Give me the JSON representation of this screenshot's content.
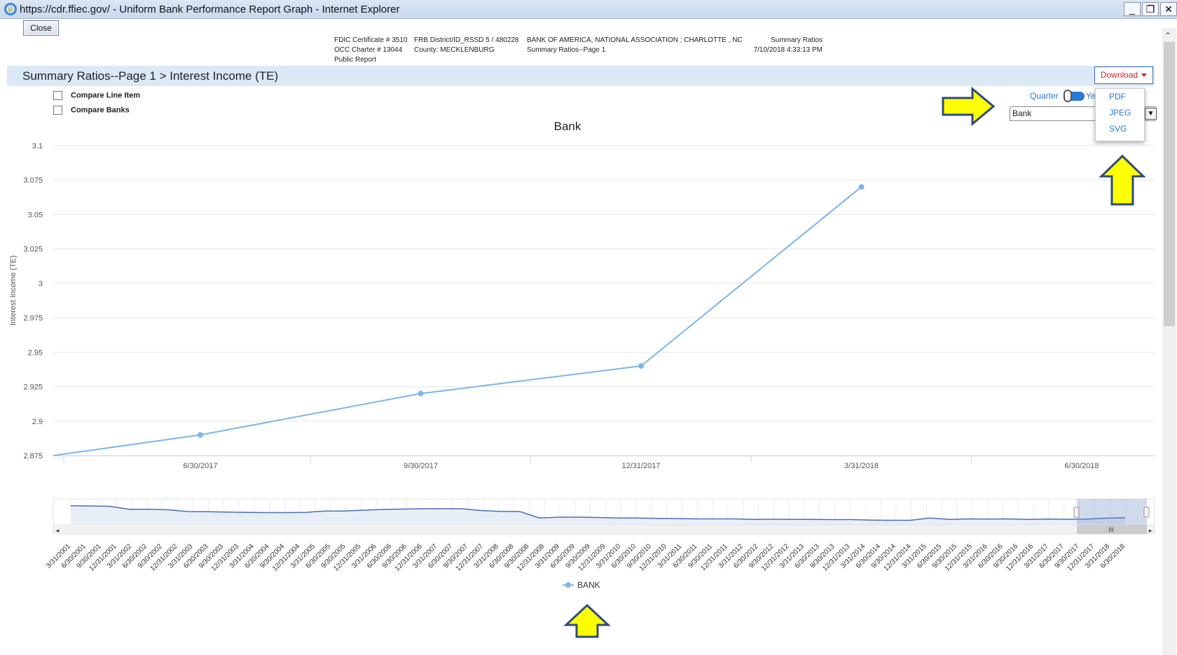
{
  "window": {
    "title": "https://cdr.ffiec.gov/ - Uniform Bank Performance Report Graph - Internet Explorer",
    "minimize": "_",
    "restore": "❐",
    "close": "✕"
  },
  "close_button": "Close",
  "header": {
    "col1": [
      "FDIC Certificate # 3510",
      "OCC Charter # 13044",
      "Public Report"
    ],
    "col2": [
      "FRB District/ID_RSSD 5 / 480228",
      "County: MECKLENBURG"
    ],
    "col3": [
      "BANK OF AMERICA, NATIONAL ASSOCIATION ; CHARLOTTE , NC",
      "Summary Ratios--Page 1"
    ],
    "col4": [
      "Summary Ratios",
      "7/10/2018 4:33:13 PM"
    ]
  },
  "section_title": "Summary Ratios--Page 1 > Interest Income (TE)",
  "download": {
    "label": "Download",
    "options": [
      "PDF",
      "JPEG",
      "SVG"
    ]
  },
  "compare": {
    "line_item": "Compare Line Item",
    "banks": "Compare Banks"
  },
  "toggle": {
    "left": "Quarter",
    "right": "Ye"
  },
  "bank_select": {
    "value": "Bank"
  },
  "colors": {
    "series": "#7cb5ec",
    "navigator_line": "#4a6fb5",
    "arrow_fill": "#ffff00",
    "arrow_stroke": "#2f4b7c"
  },
  "chart_data": {
    "type": "line",
    "title": "Bank",
    "ylabel": "Interest Income (TE)",
    "xlabel": "",
    "ylim": [
      2.875,
      3.1
    ],
    "yticks": [
      "3.1",
      "3.075",
      "3.05",
      "3.025",
      "3",
      "2.975",
      "2.95",
      "2.925",
      "2.9",
      "2.875"
    ],
    "xticks": [
      "6/30/2017",
      "9/30/2017",
      "12/31/2017",
      "3/31/2018",
      "6/30/2018"
    ],
    "series": [
      {
        "name": "BANK",
        "x": [
          "3/31/2017",
          "6/30/2017",
          "9/30/2017",
          "12/31/2017",
          "3/31/2018"
        ],
        "values": [
          2.875,
          2.89,
          2.92,
          2.94,
          3.07
        ]
      }
    ],
    "legend": "bottom-center",
    "grid": true
  },
  "navigator": {
    "labels": [
      "3/31/2001",
      "6/30/2001",
      "9/30/2001",
      "12/31/2001",
      "3/31/2002",
      "6/30/2002",
      "9/30/2002",
      "12/31/2002",
      "3/31/2003",
      "6/30/2003",
      "9/30/2003",
      "12/31/2003",
      "3/31/2004",
      "6/30/2004",
      "9/30/2004",
      "12/31/2004",
      "3/31/2005",
      "6/30/2005",
      "9/30/2005",
      "12/31/2005",
      "3/31/2006",
      "6/30/2006",
      "9/30/2006",
      "12/31/2006",
      "3/31/2007",
      "6/30/2007",
      "9/30/2007",
      "12/31/2007",
      "3/31/2008",
      "6/30/2008",
      "9/30/2008",
      "12/31/2008",
      "3/31/2009",
      "6/30/2009",
      "9/30/2009",
      "12/31/2009",
      "3/31/2010",
      "6/30/2010",
      "9/30/2010",
      "12/31/2010",
      "3/31/2011",
      "6/30/2011",
      "9/30/2011",
      "12/31/2011",
      "3/31/2012",
      "6/30/2012",
      "9/30/2012",
      "12/31/2012",
      "3/31/2013",
      "6/30/2013",
      "9/30/2013",
      "12/31/2013",
      "3/31/2014",
      "6/30/2014",
      "9/30/2014",
      "12/31/2014",
      "3/31/2015",
      "6/30/2015",
      "9/30/2015",
      "12/31/2015",
      "3/31/2016",
      "6/30/2016",
      "9/30/2016",
      "12/31/2016",
      "3/31/2017",
      "6/30/2017",
      "9/30/2017",
      "12/31/2017",
      "3/31/2018",
      "6/30/2018"
    ],
    "scroll_grip": "III"
  }
}
